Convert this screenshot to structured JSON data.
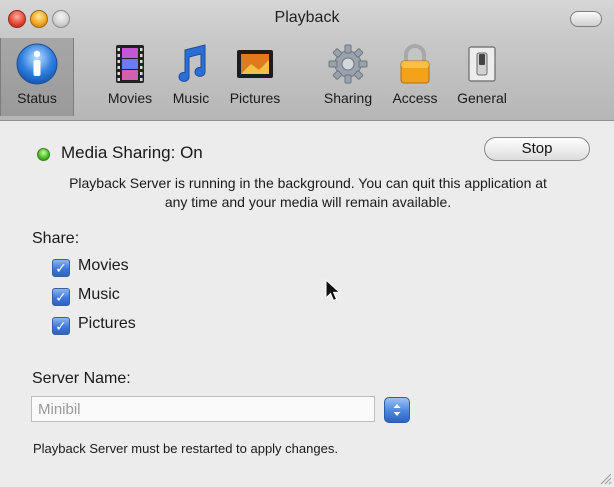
{
  "window": {
    "title": "Playback"
  },
  "toolbar": {
    "items": [
      {
        "label": "Status",
        "icon": "info-icon",
        "selected": true
      },
      {
        "label": "Movies",
        "icon": "film-icon"
      },
      {
        "label": "Music",
        "icon": "music-note-icon"
      },
      {
        "label": "Pictures",
        "icon": "picture-icon"
      },
      {
        "label": "Sharing",
        "icon": "gear-icon"
      },
      {
        "label": "Access",
        "icon": "lock-icon"
      },
      {
        "label": "General",
        "icon": "switch-icon"
      }
    ]
  },
  "status": {
    "text": "Media Sharing: On",
    "indicator_color": "#4fbf2a",
    "stop_label": "Stop",
    "description": "Playback Server is running in the background. You can quit this application at any time and your media will remain available."
  },
  "share": {
    "label": "Share:",
    "options": [
      {
        "label": "Movies",
        "checked": true
      },
      {
        "label": "Music",
        "checked": true
      },
      {
        "label": "Pictures",
        "checked": true
      }
    ]
  },
  "server": {
    "label": "Server Name:",
    "value": "Minibil",
    "note": "Playback Server must be restarted to apply changes."
  },
  "colors": {
    "accent": "#3d79d8",
    "selected_tool": "#a0a0a0"
  }
}
